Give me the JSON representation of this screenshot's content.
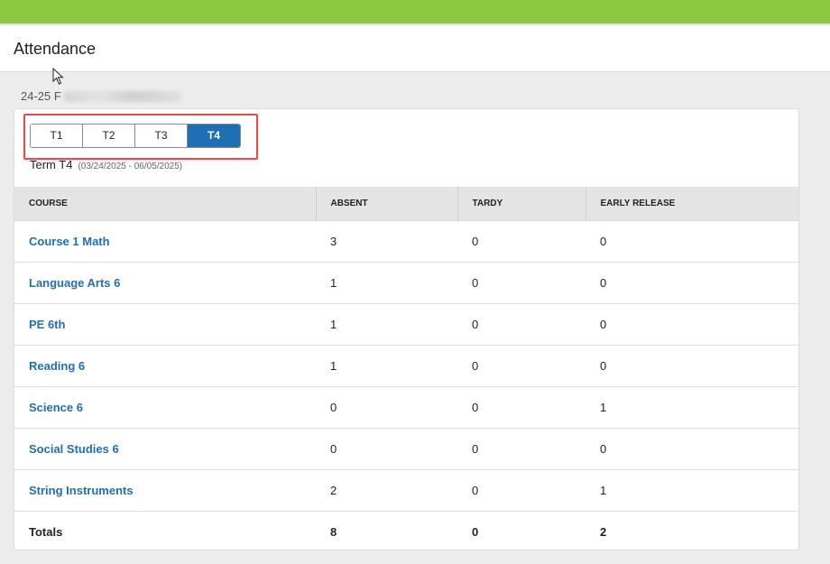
{
  "page": {
    "title": "Attendance",
    "school_year_prefix": "24-25 F"
  },
  "colors": {
    "top_bar": "#8dc63f",
    "accent": "#1f6fb5",
    "highlight": "#e74c4c"
  },
  "terms": {
    "tabs": [
      {
        "label": "T1",
        "active": false
      },
      {
        "label": "T2",
        "active": false
      },
      {
        "label": "T3",
        "active": false
      },
      {
        "label": "T4",
        "active": true
      }
    ],
    "selected_label": "Term T4",
    "selected_dates": "(03/24/2025 - 06/05/2025)"
  },
  "table": {
    "headers": [
      "COURSE",
      "ABSENT",
      "TARDY",
      "EARLY RELEASE"
    ],
    "rows": [
      {
        "course": "Course 1 Math",
        "absent": "3",
        "tardy": "0",
        "early_release": "0"
      },
      {
        "course": "Language Arts 6",
        "absent": "1",
        "tardy": "0",
        "early_release": "0"
      },
      {
        "course": "PE 6th",
        "absent": "1",
        "tardy": "0",
        "early_release": "0"
      },
      {
        "course": "Reading 6",
        "absent": "1",
        "tardy": "0",
        "early_release": "0"
      },
      {
        "course": "Science 6",
        "absent": "0",
        "tardy": "0",
        "early_release": "1"
      },
      {
        "course": "Social Studies 6",
        "absent": "0",
        "tardy": "0",
        "early_release": "0"
      },
      {
        "course": "String Instruments",
        "absent": "2",
        "tardy": "0",
        "early_release": "1"
      }
    ],
    "totals": {
      "label": "Totals",
      "absent": "8",
      "tardy": "0",
      "early_release": "2"
    }
  }
}
